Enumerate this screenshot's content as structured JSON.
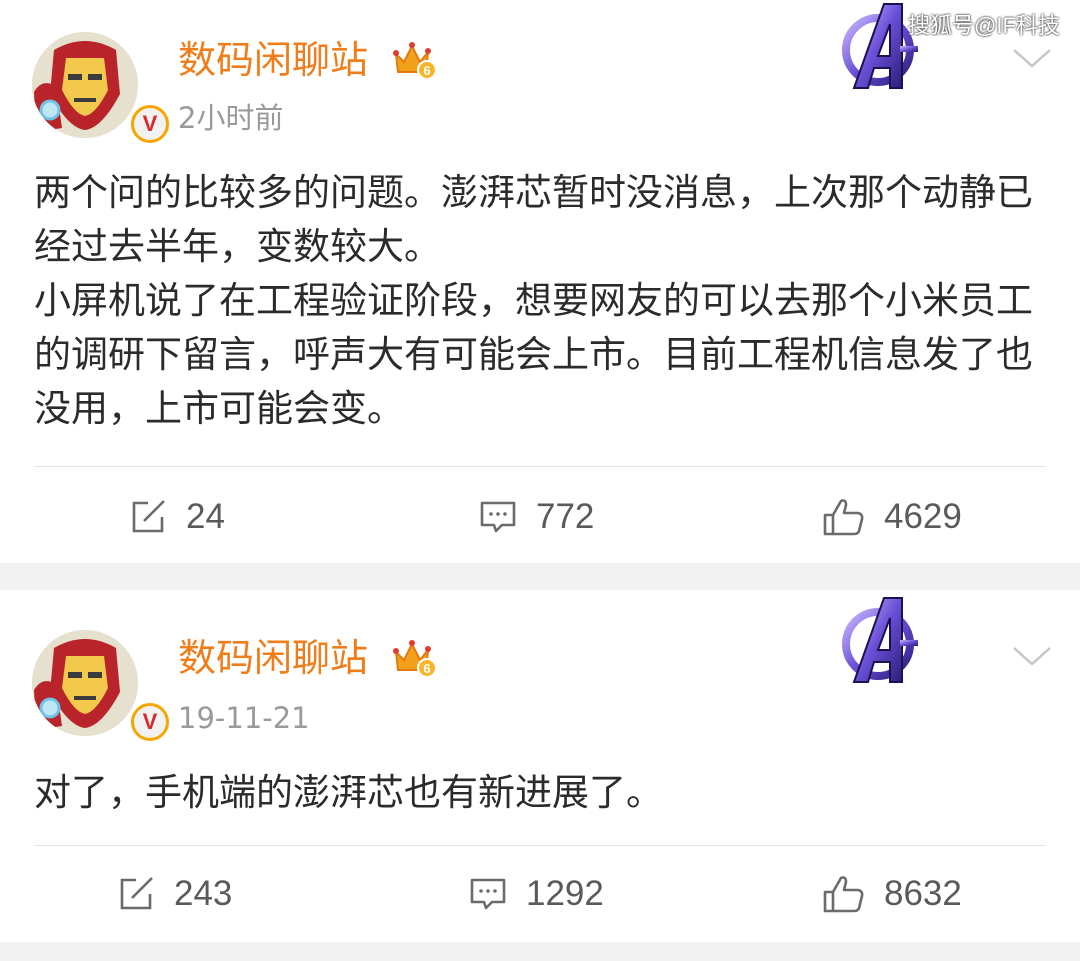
{
  "watermark": "搜狐号@IF科技",
  "posts": [
    {
      "username": "数码闲聊站",
      "level": "6",
      "verified": "V",
      "time": "2小时前",
      "content": [
        "两个问的比较多的问题。澎湃芯暂时没消息，上次那个动静已经过去半年，变数较大。",
        "小屏机说了在工程验证阶段，想要网友的可以去那个小米员工的调研下留言，呼声大有可能会上市。目前工程机信息发了也没用，上市可能会变。"
      ],
      "reposts": "24",
      "comments": "772",
      "likes": "4629"
    },
    {
      "username": "数码闲聊站",
      "level": "6",
      "verified": "V",
      "time": "19-11-21",
      "content": [
        "对了，手机端的澎湃芯也有新进展了。"
      ],
      "reposts": "243",
      "comments": "1292",
      "likes": "8632"
    }
  ],
  "colors": {
    "username": "#f07d1a",
    "text": "#2b2b2b",
    "meta": "#9a9a9a",
    "separator": "#f2f2f2"
  }
}
